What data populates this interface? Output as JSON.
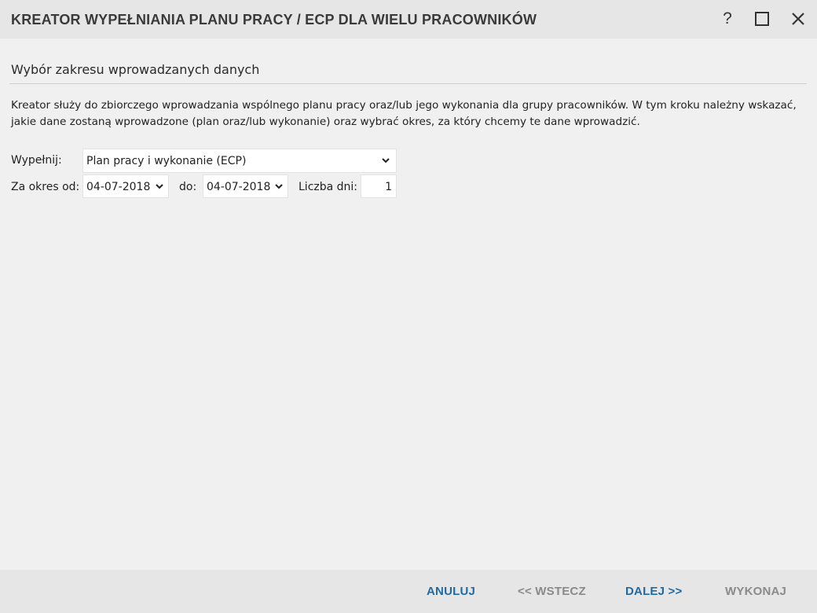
{
  "window": {
    "title": "KREATOR WYPEŁNIANIA PLANU PRACY / ECP DLA WIELU PRACOWNIKÓW",
    "help_label": "?",
    "icons": {
      "maximize": "maximize-icon",
      "close": "close-icon"
    }
  },
  "section": {
    "title": "Wybór zakresu wprowadzanych danych",
    "description": "Kreator służy do zbiorczego wprowadzania wspólnego planu pracy oraz/lub jego wykonania dla grupy pracowników. W tym kroku należny wskazać, jakie dane zostaną wprowadzone (plan oraz/lub wykonanie) oraz wybrać okres, za który chcemy te dane wprowadzić."
  },
  "form": {
    "fill_label": "Wypełnij:",
    "fill_value": "Plan pracy i wykonanie (ECP)",
    "from_label": "Za okres od:",
    "from_value": "04-07-2018",
    "to_label": "do:",
    "to_value": "04-07-2018",
    "days_label": "Liczba dni:",
    "days_value": "1"
  },
  "footer": {
    "cancel": "ANULUJ",
    "back": "<< WSTECZ",
    "next": "DALEJ >>",
    "execute": "WYKONAJ"
  },
  "colors": {
    "accent": "#1f6aa5",
    "disabled": "#8a8a8a"
  }
}
